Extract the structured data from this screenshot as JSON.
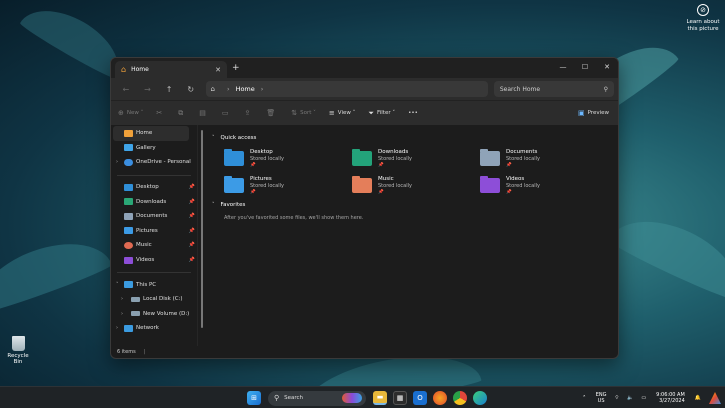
{
  "desktop": {
    "learn_label": "Learn about this picture",
    "recycle_label": "Recycle Bin"
  },
  "window": {
    "tab_title": "Home",
    "new_tab": "+",
    "controls": {
      "minimize": "—",
      "maximize": "☐",
      "close": "✕"
    },
    "address": {
      "crumb": "Home"
    },
    "search_placeholder": "Search Home",
    "commands": {
      "new": "New",
      "sort": "Sort",
      "view": "View",
      "filter": "Filter",
      "more": "•••",
      "preview": "Preview"
    },
    "sidebar": {
      "top": [
        {
          "label": "Home",
          "icon": "home-icon",
          "color": "#f0a13a"
        },
        {
          "label": "Gallery",
          "icon": "gallery-icon",
          "color": "#3fa4e8"
        },
        {
          "label": "OneDrive - Personal",
          "icon": "cloud-icon",
          "color": "#3b8ee0"
        }
      ],
      "pinned": [
        {
          "label": "Desktop",
          "icon": "desktop-icon",
          "color": "#2f8fd8"
        },
        {
          "label": "Downloads",
          "icon": "download-icon",
          "color": "#2aa776"
        },
        {
          "label": "Documents",
          "icon": "documents-icon",
          "color": "#8fa3b8"
        },
        {
          "label": "Pictures",
          "icon": "pictures-icon",
          "color": "#3c9be6"
        },
        {
          "label": "Music",
          "icon": "music-icon",
          "color": "#e06a52"
        },
        {
          "label": "Videos",
          "icon": "videos-icon",
          "color": "#8d4ed8"
        }
      ],
      "this_pc": {
        "label": "This PC",
        "icon": "pc-icon",
        "color": "#3b9be0"
      },
      "drives": [
        {
          "label": "Local Disk (C:)",
          "icon": "drive-icon",
          "color": "#8aa0b0"
        },
        {
          "label": "New Volume (D:)",
          "icon": "drive-icon",
          "color": "#8aa0b0"
        }
      ],
      "network": {
        "label": "Network",
        "icon": "network-icon",
        "color": "#3b9be0"
      }
    },
    "quick_access": {
      "title": "Quick access",
      "folders": [
        {
          "name": "Desktop",
          "sub": "Stored locally",
          "color": "#2f8fd8"
        },
        {
          "name": "Downloads",
          "sub": "Stored locally",
          "color": "#23a37a"
        },
        {
          "name": "Documents",
          "sub": "Stored locally",
          "color": "#8fa3b8"
        },
        {
          "name": "Pictures",
          "sub": "Stored locally",
          "color": "#3c9be6"
        },
        {
          "name": "Music",
          "sub": "Stored locally",
          "color": "#e47e5a"
        },
        {
          "name": "Videos",
          "sub": "Stored locally",
          "color": "#8d4ed8"
        }
      ]
    },
    "favorites": {
      "title": "Favorites",
      "empty_text": "After you've favorited some files, we'll show them here."
    },
    "status": {
      "items": "6 items",
      "separator": "|"
    }
  },
  "taskbar": {
    "search_label": "Search",
    "language": "ENG",
    "region": "US",
    "time": "9:06:00 AM",
    "date": "3/27/2024"
  }
}
